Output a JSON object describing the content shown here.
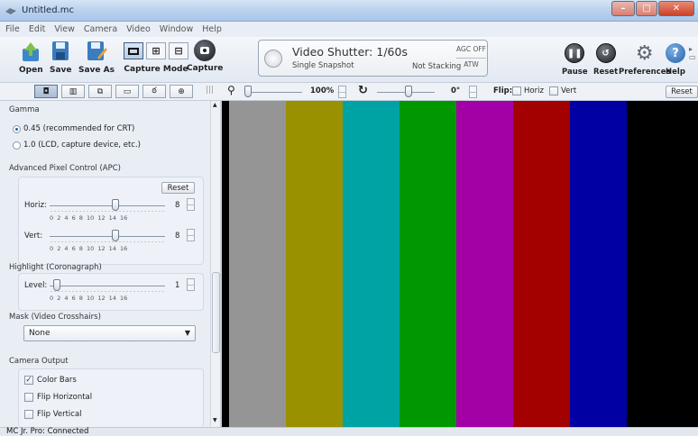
{
  "window": {
    "title": "Untitled.mc"
  },
  "menu": [
    "File",
    "Edit",
    "View",
    "Camera",
    "Video",
    "Window",
    "Help"
  ],
  "toolbar": {
    "open_label": "Open",
    "save_label": "Save",
    "save_as_label": "Save As",
    "capture_mode_label": "Capture Mode",
    "capture_label": "Capture",
    "shutter_text": "Video Shutter: 1/60s",
    "capture_type": "Single Snapshot",
    "stacking": "Not Stacking",
    "agc": "AGC OFF",
    "atw": "ATW",
    "pause_label": "Pause",
    "reset_label": "Reset",
    "preferences_label": "Preferences",
    "help_label": "Help"
  },
  "toolbar2": {
    "zoom": "100%",
    "rotation": "0°",
    "flip_label": "Flip:",
    "horiz_label": "Horiz",
    "vert_label": "Vert",
    "reset_label": "Reset"
  },
  "panel": {
    "gamma_title": "Gamma",
    "gamma_opt1": "0.45 (recommended for CRT)",
    "gamma_opt2": "1.0 (LCD, capture device, etc.)",
    "apc_title": "Advanced Pixel Control (APC)",
    "apc_reset": "Reset",
    "horiz_label": "Horiz:",
    "horiz_value": "8",
    "vert_label": "Vert:",
    "vert_value": "8",
    "tick_labels": "0 2 4 6 8 10 12 14 16",
    "highlight_title": "Highlight (Coronagraph)",
    "level_label": "Level:",
    "level_value": "1",
    "mask_title": "Mask (Video Crosshairs)",
    "mask_value": "None",
    "output_title": "Camera Output",
    "color_bars": "Color Bars",
    "flip_h": "Flip Horizontal",
    "flip_v": "Flip Vertical"
  },
  "video": {
    "bars": [
      "#959595",
      "#999100",
      "#00a3a3",
      "#009700",
      "#a300a6",
      "#a30000",
      "#0000a3",
      "#000000"
    ]
  },
  "status": {
    "text": "MC Jr. Pro: Connected"
  }
}
